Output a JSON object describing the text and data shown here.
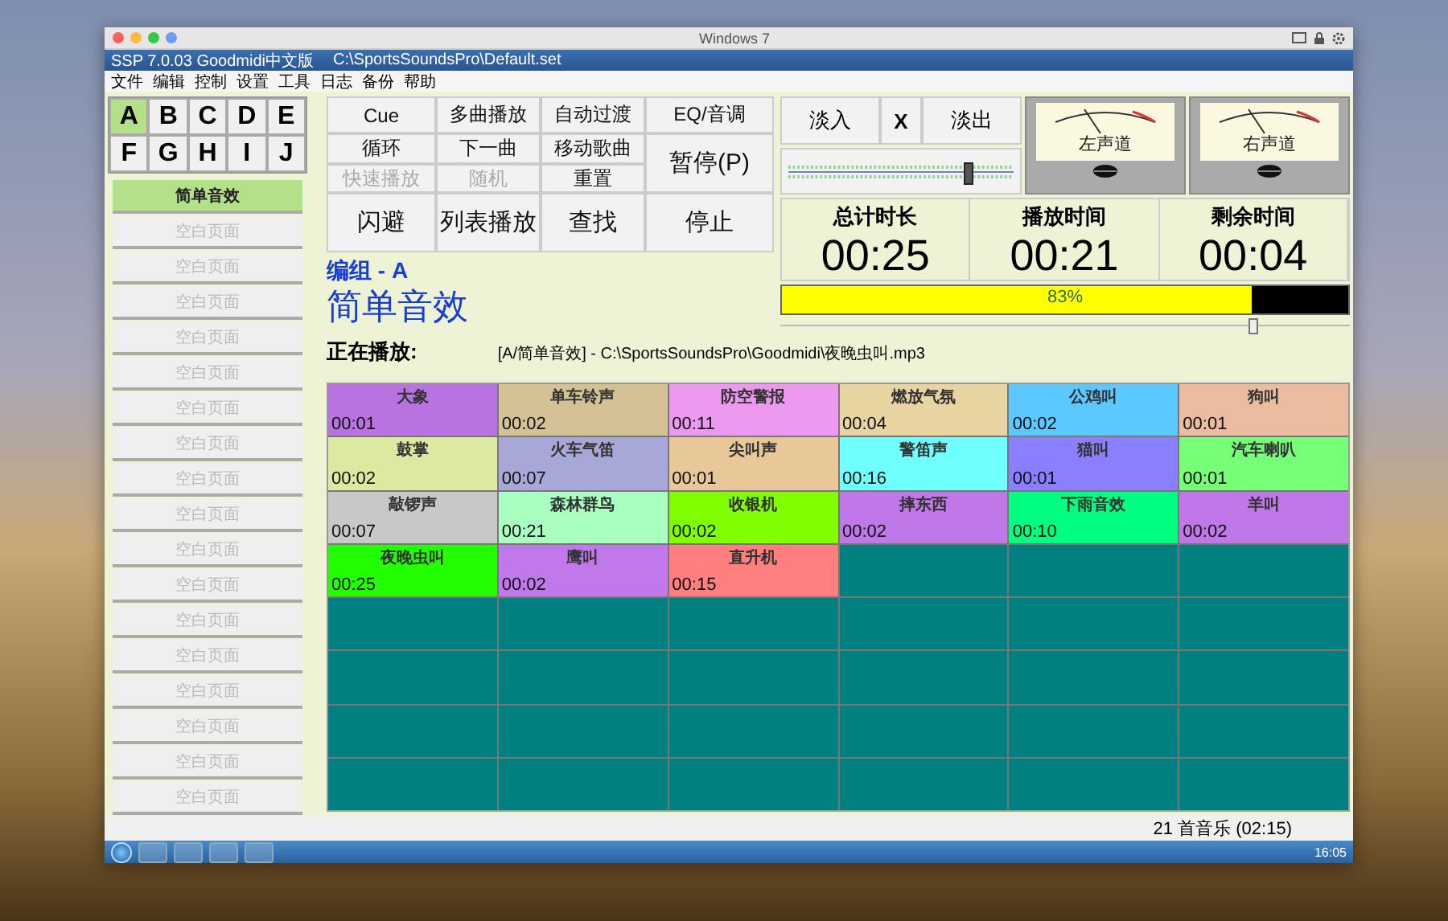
{
  "mac_window": {
    "title": "Windows 7"
  },
  "app": {
    "title": "SSP 7.0.03 Goodmidi中文版",
    "path": "C:\\SportsSoundsPro\\Default.set"
  },
  "menu": [
    "文件",
    "编辑",
    "控制",
    "设置",
    "工具",
    "日志",
    "备份",
    "帮助"
  ],
  "letters": [
    {
      "label": "A",
      "selected": true
    },
    {
      "label": "B",
      "selected": false
    },
    {
      "label": "C",
      "selected": false
    },
    {
      "label": "D",
      "selected": false
    },
    {
      "label": "E",
      "selected": false
    },
    {
      "label": "F",
      "selected": false
    },
    {
      "label": "G",
      "selected": false
    },
    {
      "label": "H",
      "selected": false
    },
    {
      "label": "I",
      "selected": false
    },
    {
      "label": "J",
      "selected": false
    }
  ],
  "pages": [
    {
      "label": "简单音效",
      "selected": true
    },
    {
      "label": "空白页面",
      "selected": false
    },
    {
      "label": "空白页面",
      "selected": false
    },
    {
      "label": "空白页面",
      "selected": false
    },
    {
      "label": "空白页面",
      "selected": false
    },
    {
      "label": "空白页面",
      "selected": false
    },
    {
      "label": "空白页面",
      "selected": false
    },
    {
      "label": "空白页面",
      "selected": false
    },
    {
      "label": "空白页面",
      "selected": false
    },
    {
      "label": "空白页面",
      "selected": false
    },
    {
      "label": "空白页面",
      "selected": false
    },
    {
      "label": "空白页面",
      "selected": false
    },
    {
      "label": "空白页面",
      "selected": false
    },
    {
      "label": "空白页面",
      "selected": false
    },
    {
      "label": "空白页面",
      "selected": false
    },
    {
      "label": "空白页面",
      "selected": false
    },
    {
      "label": "空白页面",
      "selected": false
    },
    {
      "label": "空白页面",
      "selected": false
    }
  ],
  "buttons": [
    {
      "label": "Cue",
      "disabled": false
    },
    {
      "label": "多曲播放",
      "disabled": false
    },
    {
      "label": "自动过渡",
      "disabled": false
    },
    {
      "label": "循环",
      "disabled": false
    },
    {
      "label": "下一曲",
      "disabled": false
    },
    {
      "label": "移动歌曲",
      "disabled": false
    },
    {
      "label": "快速播放",
      "disabled": true
    },
    {
      "label": "随机",
      "disabled": true
    },
    {
      "label": "重置",
      "disabled": false
    },
    {
      "label": "闪避",
      "disabled": false
    },
    {
      "label": "列表播放",
      "disabled": false
    },
    {
      "label": "查找",
      "disabled": false
    }
  ],
  "side_buttons": [
    "EQ/音调",
    "暂停(P)",
    "停止"
  ],
  "group": {
    "label": "编组 - A",
    "name": "简单音效"
  },
  "now_playing": {
    "label": "正在播放:",
    "value": "[A/简单音效] - C:\\SportsSoundsPro\\Goodmidi\\夜晚虫叫.mp3"
  },
  "fade": {
    "buttons": [
      "淡入",
      "X",
      "淡出"
    ],
    "level": 0.8
  },
  "meters": [
    {
      "label": "左声道"
    },
    {
      "label": "右声道"
    }
  ],
  "times": [
    {
      "label": "总计时长",
      "value": "00:25"
    },
    {
      "label": "播放时间",
      "value": "00:21"
    },
    {
      "label": "剩余时间",
      "value": "00:04"
    }
  ],
  "progress": {
    "level": 0.83,
    "reading": "83%"
  },
  "position": {
    "level": 0.83
  },
  "cells": [
    {
      "name": "大象",
      "time": "00:01",
      "color": "#b873e0"
    },
    {
      "name": "单车铃声",
      "time": "00:02",
      "color": "#d4c195"
    },
    {
      "name": "防空警报",
      "time": "00:11",
      "color": "#ee99f0"
    },
    {
      "name": "燃放气氛",
      "time": "00:04",
      "color": "#e8d4a0"
    },
    {
      "name": "公鸡叫",
      "time": "00:02",
      "color": "#5bc8ff"
    },
    {
      "name": "狗叫",
      "time": "00:01",
      "color": "#ebbca0"
    },
    {
      "name": "鼓掌",
      "time": "00:02",
      "color": "#dde8a0"
    },
    {
      "name": "火车气笛",
      "time": "00:07",
      "color": "#a8a8d8"
    },
    {
      "name": "尖叫声",
      "time": "00:01",
      "color": "#e8c898"
    },
    {
      "name": "警笛声",
      "time": "00:16",
      "color": "#70ffff"
    },
    {
      "name": "猫叫",
      "time": "00:01",
      "color": "#8a80ff"
    },
    {
      "name": "汽车喇叭",
      "time": "00:01",
      "color": "#78ff78"
    },
    {
      "name": "敲锣声",
      "time": "00:07",
      "color": "#c8c8c8"
    },
    {
      "name": "森林群鸟",
      "time": "00:21",
      "color": "#a8ffc0"
    },
    {
      "name": "收银机",
      "time": "00:02",
      "color": "#80ff00"
    },
    {
      "name": "摔东西",
      "time": "00:02",
      "color": "#c078e8"
    },
    {
      "name": "下雨音效",
      "time": "00:10",
      "color": "#00ff80"
    },
    {
      "name": "羊叫",
      "time": "00:02",
      "color": "#c078e9"
    },
    {
      "name": "夜晚虫叫",
      "time": "00:25",
      "color": "#22ff00"
    },
    {
      "name": "鹰叫",
      "time": "00:02",
      "color": "#c078ea"
    },
    {
      "name": "直升机",
      "time": "00:15",
      "color": "#ff7f7f"
    }
  ],
  "status_bar": "21 首音乐 (02:15)",
  "taskbar": {
    "clock": "16:05"
  }
}
